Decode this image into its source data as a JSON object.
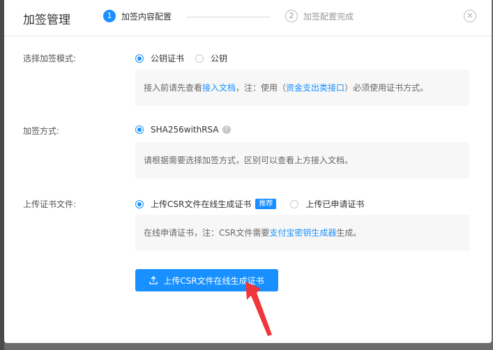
{
  "modal": {
    "title": "加签管理",
    "close": "×"
  },
  "steps": [
    {
      "number": "1",
      "label": "加签内容配置"
    },
    {
      "number": "2",
      "label": "加签配置完成"
    }
  ],
  "mode": {
    "label": "选择加签模式:",
    "options": [
      {
        "label": "公钥证书",
        "checked": true
      },
      {
        "label": "公钥",
        "checked": false
      }
    ],
    "note": {
      "part1": "接入前请先查看",
      "link1": "接入文档",
      "part2": "，注：使用（",
      "link2": "资金支出类接口",
      "part3": "）必须使用证书方式。"
    }
  },
  "method": {
    "label": "加签方式:",
    "option": "SHA256withRSA",
    "help": "?",
    "note": "请根据需要选择加签方式，区别可以查看上方接入文档。"
  },
  "upload": {
    "label": "上传证书文件:",
    "options": [
      {
        "label": "上传CSR文件在线生成证书",
        "badge": "推荐",
        "checked": true
      },
      {
        "label": "上传已申请证书",
        "checked": false
      }
    ],
    "note": {
      "part1": "在线申请证书，注：CSR文件需要",
      "link": "支付宝密钥生成器",
      "part2": "生成。"
    },
    "button": "上传CSR文件在线生成证书"
  },
  "colors": {
    "primary": "#1890ff",
    "annotation_arrow": "#f0353b"
  }
}
